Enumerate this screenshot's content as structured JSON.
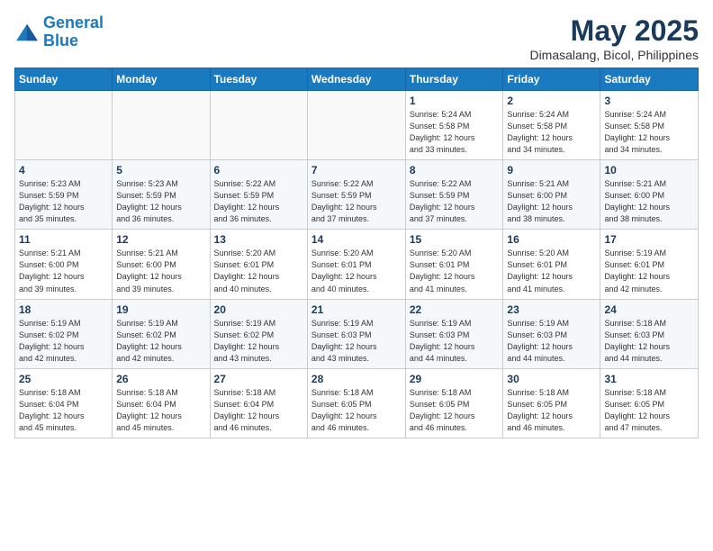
{
  "logo": {
    "line1": "General",
    "line2": "Blue"
  },
  "title": "May 2025",
  "subtitle": "Dimasalang, Bicol, Philippines",
  "days_of_week": [
    "Sunday",
    "Monday",
    "Tuesday",
    "Wednesday",
    "Thursday",
    "Friday",
    "Saturday"
  ],
  "weeks": [
    [
      {
        "day": "",
        "info": ""
      },
      {
        "day": "",
        "info": ""
      },
      {
        "day": "",
        "info": ""
      },
      {
        "day": "",
        "info": ""
      },
      {
        "day": "1",
        "info": "Sunrise: 5:24 AM\nSunset: 5:58 PM\nDaylight: 12 hours\nand 33 minutes."
      },
      {
        "day": "2",
        "info": "Sunrise: 5:24 AM\nSunset: 5:58 PM\nDaylight: 12 hours\nand 34 minutes."
      },
      {
        "day": "3",
        "info": "Sunrise: 5:24 AM\nSunset: 5:58 PM\nDaylight: 12 hours\nand 34 minutes."
      }
    ],
    [
      {
        "day": "4",
        "info": "Sunrise: 5:23 AM\nSunset: 5:59 PM\nDaylight: 12 hours\nand 35 minutes."
      },
      {
        "day": "5",
        "info": "Sunrise: 5:23 AM\nSunset: 5:59 PM\nDaylight: 12 hours\nand 36 minutes."
      },
      {
        "day": "6",
        "info": "Sunrise: 5:22 AM\nSunset: 5:59 PM\nDaylight: 12 hours\nand 36 minutes."
      },
      {
        "day": "7",
        "info": "Sunrise: 5:22 AM\nSunset: 5:59 PM\nDaylight: 12 hours\nand 37 minutes."
      },
      {
        "day": "8",
        "info": "Sunrise: 5:22 AM\nSunset: 5:59 PM\nDaylight: 12 hours\nand 37 minutes."
      },
      {
        "day": "9",
        "info": "Sunrise: 5:21 AM\nSunset: 6:00 PM\nDaylight: 12 hours\nand 38 minutes."
      },
      {
        "day": "10",
        "info": "Sunrise: 5:21 AM\nSunset: 6:00 PM\nDaylight: 12 hours\nand 38 minutes."
      }
    ],
    [
      {
        "day": "11",
        "info": "Sunrise: 5:21 AM\nSunset: 6:00 PM\nDaylight: 12 hours\nand 39 minutes."
      },
      {
        "day": "12",
        "info": "Sunrise: 5:21 AM\nSunset: 6:00 PM\nDaylight: 12 hours\nand 39 minutes."
      },
      {
        "day": "13",
        "info": "Sunrise: 5:20 AM\nSunset: 6:01 PM\nDaylight: 12 hours\nand 40 minutes."
      },
      {
        "day": "14",
        "info": "Sunrise: 5:20 AM\nSunset: 6:01 PM\nDaylight: 12 hours\nand 40 minutes."
      },
      {
        "day": "15",
        "info": "Sunrise: 5:20 AM\nSunset: 6:01 PM\nDaylight: 12 hours\nand 41 minutes."
      },
      {
        "day": "16",
        "info": "Sunrise: 5:20 AM\nSunset: 6:01 PM\nDaylight: 12 hours\nand 41 minutes."
      },
      {
        "day": "17",
        "info": "Sunrise: 5:19 AM\nSunset: 6:01 PM\nDaylight: 12 hours\nand 42 minutes."
      }
    ],
    [
      {
        "day": "18",
        "info": "Sunrise: 5:19 AM\nSunset: 6:02 PM\nDaylight: 12 hours\nand 42 minutes."
      },
      {
        "day": "19",
        "info": "Sunrise: 5:19 AM\nSunset: 6:02 PM\nDaylight: 12 hours\nand 42 minutes."
      },
      {
        "day": "20",
        "info": "Sunrise: 5:19 AM\nSunset: 6:02 PM\nDaylight: 12 hours\nand 43 minutes."
      },
      {
        "day": "21",
        "info": "Sunrise: 5:19 AM\nSunset: 6:03 PM\nDaylight: 12 hours\nand 43 minutes."
      },
      {
        "day": "22",
        "info": "Sunrise: 5:19 AM\nSunset: 6:03 PM\nDaylight: 12 hours\nand 44 minutes."
      },
      {
        "day": "23",
        "info": "Sunrise: 5:19 AM\nSunset: 6:03 PM\nDaylight: 12 hours\nand 44 minutes."
      },
      {
        "day": "24",
        "info": "Sunrise: 5:18 AM\nSunset: 6:03 PM\nDaylight: 12 hours\nand 44 minutes."
      }
    ],
    [
      {
        "day": "25",
        "info": "Sunrise: 5:18 AM\nSunset: 6:04 PM\nDaylight: 12 hours\nand 45 minutes."
      },
      {
        "day": "26",
        "info": "Sunrise: 5:18 AM\nSunset: 6:04 PM\nDaylight: 12 hours\nand 45 minutes."
      },
      {
        "day": "27",
        "info": "Sunrise: 5:18 AM\nSunset: 6:04 PM\nDaylight: 12 hours\nand 46 minutes."
      },
      {
        "day": "28",
        "info": "Sunrise: 5:18 AM\nSunset: 6:05 PM\nDaylight: 12 hours\nand 46 minutes."
      },
      {
        "day": "29",
        "info": "Sunrise: 5:18 AM\nSunset: 6:05 PM\nDaylight: 12 hours\nand 46 minutes."
      },
      {
        "day": "30",
        "info": "Sunrise: 5:18 AM\nSunset: 6:05 PM\nDaylight: 12 hours\nand 46 minutes."
      },
      {
        "day": "31",
        "info": "Sunrise: 5:18 AM\nSunset: 6:05 PM\nDaylight: 12 hours\nand 47 minutes."
      }
    ]
  ]
}
